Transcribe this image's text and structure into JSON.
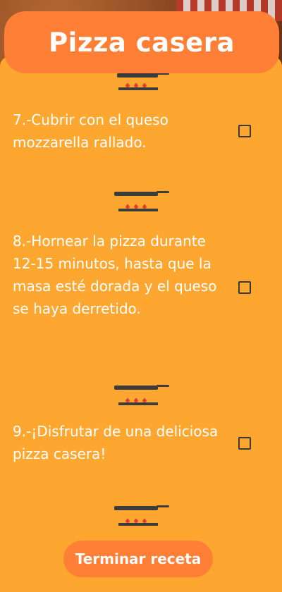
{
  "header": {
    "title": "Pizza casera"
  },
  "steps": [
    {
      "text": "7.-Cubrir con el queso mozzarella rallado.",
      "checked": false
    },
    {
      "text": "8.-Hornear la pizza durante 12-15 minutos, hasta que la masa esté dorada y el queso se haya derretido.",
      "checked": false
    },
    {
      "text": "9.-¡Disfrutar de una deliciosa pizza casera!",
      "checked": false
    }
  ],
  "icons": {
    "stove": "pan-on-stove-icon"
  },
  "footer": {
    "finish_label": "Terminar receta"
  },
  "colors": {
    "panel": "#FDA731",
    "header": "#FE7F35",
    "button": "#FE7F35",
    "text": "#FFFFFF",
    "flame": "#E53935"
  }
}
